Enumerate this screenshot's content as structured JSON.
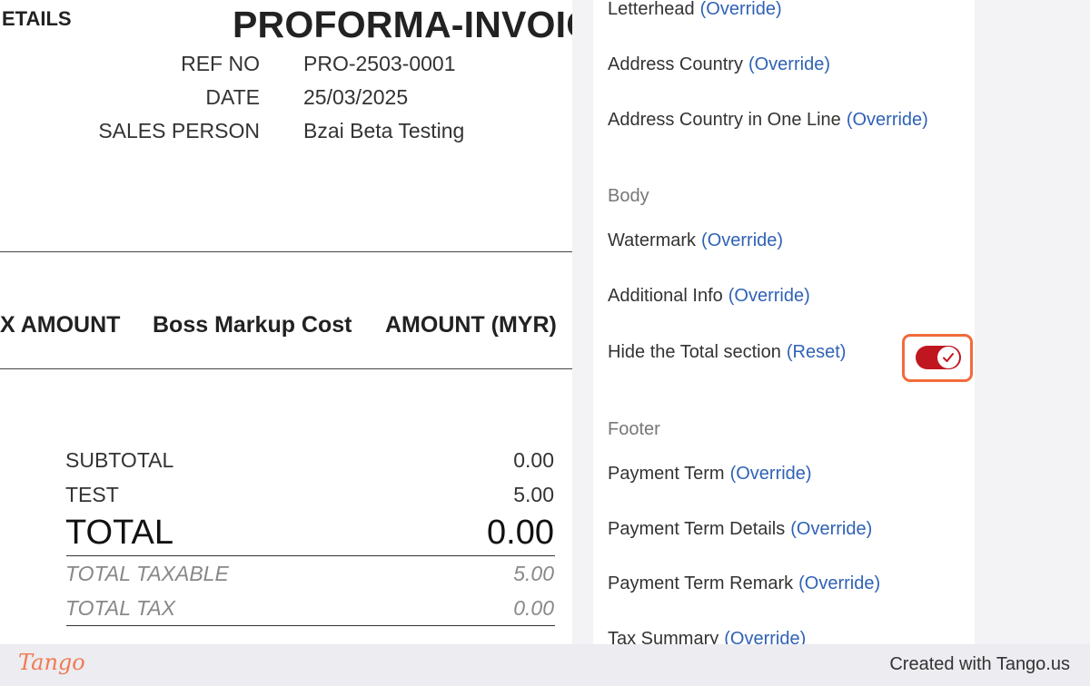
{
  "invoice": {
    "section_fragment": "ETAILS",
    "title": "PROFORMA-INVOICE",
    "meta": [
      {
        "label": "REF NO",
        "value": "PRO-2503-0001"
      },
      {
        "label": "DATE",
        "value": "25/03/2025"
      },
      {
        "label": "SALES PERSON",
        "value": "Bzai Beta Testing"
      }
    ],
    "columns": [
      "X AMOUNT",
      "Boss Markup Cost",
      "AMOUNT (MYR)"
    ],
    "summary": {
      "subtotal_label": "SUBTOTAL",
      "subtotal_value": "0.00",
      "test_label": "TEST",
      "test_value": "5.00",
      "total_label": "TOTAL",
      "total_value": "0.00",
      "taxable_label": "TOTAL TAXABLE",
      "taxable_value": "5.00",
      "tax_label": "TOTAL TAX",
      "tax_value": "0.00"
    }
  },
  "settings": {
    "header_items": [
      {
        "label": "Letterhead",
        "action": "(Override)"
      },
      {
        "label": "Address Country",
        "action": "(Override)"
      },
      {
        "label": "Address Country in One Line",
        "action": "(Override)"
      }
    ],
    "body_heading": "Body",
    "body_items": [
      {
        "label": "Watermark",
        "action": "(Override)"
      },
      {
        "label": "Additional Info",
        "action": "(Override)"
      },
      {
        "label": "Hide the Total section",
        "action": "(Reset)"
      }
    ],
    "hide_total_enabled": true,
    "footer_heading": "Footer",
    "footer_items": [
      {
        "label": "Payment Term",
        "action": "(Override)"
      },
      {
        "label": "Payment Term Details",
        "action": "(Override)"
      },
      {
        "label": "Payment Term Remark",
        "action": "(Override)"
      },
      {
        "label": "Tax Summary",
        "action": "(Override)"
      }
    ]
  },
  "footer_bar": {
    "brand": "Tango",
    "credit": "Created with Tango.us"
  },
  "colors": {
    "toggle_on": "#c0161f",
    "link": "#2f62b5",
    "highlight": "#f26b3a"
  }
}
